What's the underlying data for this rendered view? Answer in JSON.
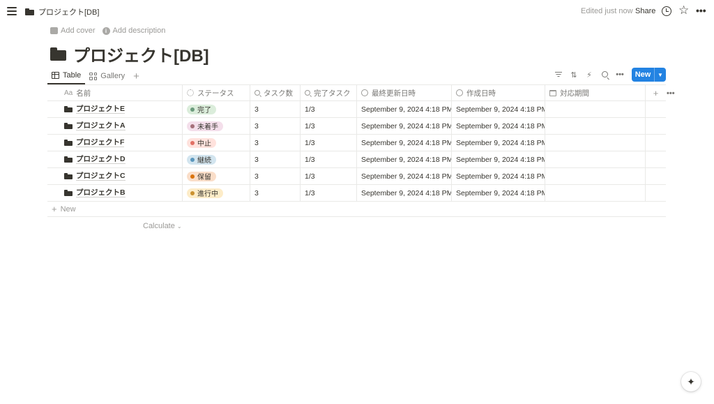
{
  "topbar": {
    "breadcrumb": "プロジェクト[DB]",
    "edited": "Edited just now",
    "share": "Share"
  },
  "page": {
    "add_cover": "Add cover",
    "add_description": "Add description",
    "title": "プロジェクト[DB]"
  },
  "views": {
    "tabs": [
      {
        "label": "Table",
        "icon": "table-icon",
        "active": true
      },
      {
        "label": "Gallery",
        "icon": "gallery-icon",
        "active": false
      }
    ],
    "new_button": "New"
  },
  "table": {
    "columns": [
      {
        "label": "名前",
        "icon": "Aa"
      },
      {
        "label": "ステータス",
        "icon": "status-icon"
      },
      {
        "label": "タスク数",
        "icon": "search-icon"
      },
      {
        "label": "完了タスク",
        "icon": "search-icon"
      },
      {
        "label": "最終更新日時",
        "icon": "clock-icon"
      },
      {
        "label": "作成日時",
        "icon": "clock-icon"
      },
      {
        "label": "対応期間",
        "icon": "calendar-icon"
      }
    ],
    "rows": [
      {
        "name": "プロジェクトE",
        "status": "完了",
        "tasks": "3",
        "done": "1/3",
        "updated": "September 9, 2024 4:18 PM",
        "created": "September 9, 2024 4:18 PM",
        "period": ""
      },
      {
        "name": "プロジェクトA",
        "status": "未着手",
        "tasks": "3",
        "done": "1/3",
        "updated": "September 9, 2024 4:18 PM",
        "created": "September 9, 2024 4:18 PM",
        "period": ""
      },
      {
        "name": "プロジェクトF",
        "status": "中止",
        "tasks": "3",
        "done": "1/3",
        "updated": "September 9, 2024 4:18 PM",
        "created": "September 9, 2024 4:18 PM",
        "period": ""
      },
      {
        "name": "プロジェクトD",
        "status": "継続",
        "tasks": "3",
        "done": "1/3",
        "updated": "September 9, 2024 4:18 PM",
        "created": "September 9, 2024 4:18 PM",
        "period": ""
      },
      {
        "name": "プロジェクトC",
        "status": "保留",
        "tasks": "3",
        "done": "1/3",
        "updated": "September 9, 2024 4:18 PM",
        "created": "September 9, 2024 4:18 PM",
        "period": ""
      },
      {
        "name": "プロジェクトB",
        "status": "進行中",
        "tasks": "3",
        "done": "1/3",
        "updated": "September 9, 2024 4:18 PM",
        "created": "September 9, 2024 4:18 PM",
        "period": ""
      }
    ],
    "status_colors": {
      "完了": {
        "bg": "#dbeddb",
        "dot": "#6c9b7d"
      },
      "未着手": {
        "bg": "#f4dfeb",
        "dot": "#a5707a"
      },
      "中止": {
        "bg": "#ffe2dd",
        "dot": "#e16f64"
      },
      "継続": {
        "bg": "#d3e5ef",
        "dot": "#5b97bd"
      },
      "保留": {
        "bg": "#fadec9",
        "dot": "#d9730d"
      },
      "進行中": {
        "bg": "#fdecc8",
        "dot": "#cb912f"
      }
    },
    "new_row": "New",
    "calculate": "Calculate"
  },
  "colors": {
    "accent": "#2383e2",
    "text": "#37352f",
    "muted": "#9b9a97"
  }
}
